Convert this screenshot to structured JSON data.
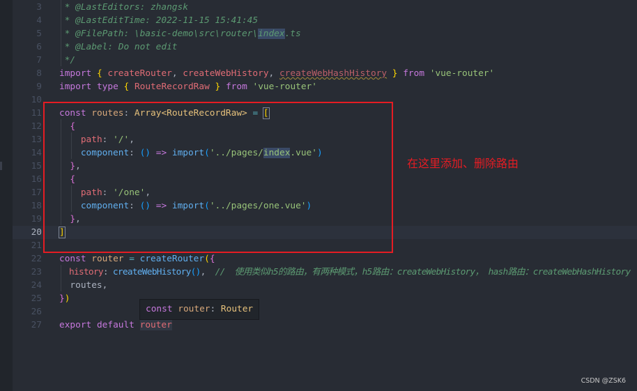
{
  "editor": {
    "current_line": 20,
    "lines": [
      {
        "n": 3,
        "t": [
          [
            "cm",
            " * @LastEditors: zhangsk"
          ]
        ]
      },
      {
        "n": 4,
        "t": [
          [
            "cm",
            " * @LastEditTime: 2022-11-15 15:41:45"
          ]
        ]
      },
      {
        "n": 5,
        "t": [
          [
            "cm",
            " * @FilePath: \\basic-demo\\src\\router\\"
          ],
          [
            "cm sel",
            "index"
          ],
          [
            "cm",
            ".ts"
          ]
        ]
      },
      {
        "n": 6,
        "t": [
          [
            "cm",
            " * @Label: Do not edit"
          ]
        ]
      },
      {
        "n": 7,
        "t": [
          [
            "cm",
            " */"
          ]
        ]
      },
      {
        "n": 8,
        "t": [
          [
            "kw",
            "import"
          ],
          [
            "pl",
            " "
          ],
          [
            "p1",
            "{"
          ],
          [
            "pl",
            " "
          ],
          [
            "id",
            "createRouter"
          ],
          [
            "pl",
            ", "
          ],
          [
            "id",
            "createWebHistory"
          ],
          [
            "pl",
            ", "
          ],
          [
            "warn",
            "createWebHashHistory"
          ],
          [
            "pl",
            " "
          ],
          [
            "p1",
            "}"
          ],
          [
            "pl",
            " "
          ],
          [
            "kw",
            "from"
          ],
          [
            "pl",
            " "
          ],
          [
            "str",
            "'vue-router'"
          ]
        ]
      },
      {
        "n": 9,
        "t": [
          [
            "kw",
            "import"
          ],
          [
            "pl",
            " "
          ],
          [
            "kw",
            "type"
          ],
          [
            "pl",
            " "
          ],
          [
            "p1",
            "{"
          ],
          [
            "pl",
            " "
          ],
          [
            "id",
            "RouteRecordRaw"
          ],
          [
            "pl",
            " "
          ],
          [
            "p1",
            "}"
          ],
          [
            "pl",
            " "
          ],
          [
            "kw",
            "from"
          ],
          [
            "pl",
            " "
          ],
          [
            "str",
            "'vue-router'"
          ]
        ]
      },
      {
        "n": 10,
        "t": []
      },
      {
        "n": 11,
        "t": [
          [
            "kw",
            "const"
          ],
          [
            "pl",
            " "
          ],
          [
            "var",
            "routes"
          ],
          [
            "pl",
            ": "
          ],
          [
            "ty",
            "Array"
          ],
          [
            "ty",
            "<"
          ],
          [
            "ty",
            "RouteRecordRaw"
          ],
          [
            "ty",
            ">"
          ],
          [
            "pl",
            " "
          ],
          [
            "op",
            "="
          ],
          [
            "pl",
            " "
          ],
          [
            "p1 bm",
            "["
          ]
        ]
      },
      {
        "n": 12,
        "t": [
          [
            "pl",
            "  "
          ],
          [
            "p2",
            "{"
          ]
        ]
      },
      {
        "n": 13,
        "t": [
          [
            "pl",
            "    "
          ],
          [
            "id",
            "path"
          ],
          [
            "pl",
            ": "
          ],
          [
            "str",
            "'/'"
          ],
          [
            "pl",
            ","
          ]
        ]
      },
      {
        "n": 14,
        "t": [
          [
            "pl",
            "    "
          ],
          [
            "fn",
            "component"
          ],
          [
            "pl",
            ": "
          ],
          [
            "p3",
            "()"
          ],
          [
            "pl",
            " "
          ],
          [
            "kw",
            "=>"
          ],
          [
            "pl",
            " "
          ],
          [
            "fn",
            "import"
          ],
          [
            "p3",
            "("
          ],
          [
            "str",
            "'../pages/"
          ],
          [
            "str sel",
            "index"
          ],
          [
            "str",
            ".vue'"
          ],
          [
            "p3",
            ")"
          ]
        ]
      },
      {
        "n": 15,
        "t": [
          [
            "pl",
            "  "
          ],
          [
            "p2",
            "}"
          ],
          [
            "pl",
            ","
          ]
        ]
      },
      {
        "n": 16,
        "t": [
          [
            "pl",
            "  "
          ],
          [
            "p2",
            "{"
          ]
        ]
      },
      {
        "n": 17,
        "t": [
          [
            "pl",
            "    "
          ],
          [
            "id",
            "path"
          ],
          [
            "pl",
            ": "
          ],
          [
            "str",
            "'/one'"
          ],
          [
            "pl",
            ","
          ]
        ]
      },
      {
        "n": 18,
        "t": [
          [
            "pl",
            "    "
          ],
          [
            "fn",
            "component"
          ],
          [
            "pl",
            ": "
          ],
          [
            "p3",
            "()"
          ],
          [
            "pl",
            " "
          ],
          [
            "kw",
            "=>"
          ],
          [
            "pl",
            " "
          ],
          [
            "fn",
            "import"
          ],
          [
            "p3",
            "("
          ],
          [
            "str",
            "'../pages/one.vue'"
          ],
          [
            "p3",
            ")"
          ]
        ]
      },
      {
        "n": 19,
        "t": [
          [
            "pl",
            "  "
          ],
          [
            "p2",
            "}"
          ],
          [
            "pl",
            ","
          ]
        ]
      },
      {
        "n": 20,
        "t": [
          [
            "p1 bm",
            "]"
          ]
        ]
      },
      {
        "n": 21,
        "t": []
      },
      {
        "n": 22,
        "t": [
          [
            "kw",
            "const"
          ],
          [
            "pl",
            " "
          ],
          [
            "var",
            "router"
          ],
          [
            "pl",
            " "
          ],
          [
            "op",
            "="
          ],
          [
            "pl",
            " "
          ],
          [
            "fn",
            "createRouter"
          ],
          [
            "p1",
            "("
          ],
          [
            "p2",
            "{"
          ]
        ]
      },
      {
        "n": 23,
        "t": [
          [
            "pl",
            "  "
          ],
          [
            "id",
            "history"
          ],
          [
            "pl",
            ": "
          ],
          [
            "fn",
            "createWebHistory"
          ],
          [
            "p3",
            "()"
          ],
          [
            "pl",
            ",  "
          ],
          [
            "cm",
            "//  使用类似h5的路由，有两种模式，h5路由：createWebHistory， hash路由：createWebHashHistory"
          ]
        ]
      },
      {
        "n": 24,
        "t": [
          [
            "pl",
            "  routes,"
          ]
        ]
      },
      {
        "n": 25,
        "t": [
          [
            "p2",
            "}"
          ],
          [
            "p1",
            ")"
          ]
        ]
      },
      {
        "n": 26,
        "t": []
      },
      {
        "n": 27,
        "t": [
          [
            "kw",
            "export"
          ],
          [
            "pl",
            " "
          ],
          [
            "kw",
            "default"
          ],
          [
            "pl",
            " "
          ],
          [
            "id hl",
            "router"
          ]
        ]
      }
    ]
  },
  "tooltip": {
    "kw": "const",
    "name": "router",
    "sep": ": ",
    "type": "Router"
  },
  "annotation": {
    "text": "在这里添加、删除路由",
    "color": "#e51c23"
  },
  "watermark": "CSDN @ZSK6"
}
